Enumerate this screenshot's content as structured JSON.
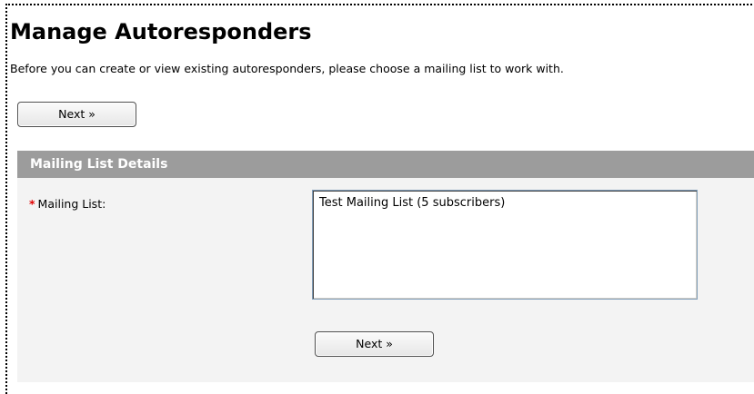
{
  "page": {
    "title": "Manage Autoresponders",
    "intro": "Before you can create or view existing autoresponders, please choose a mailing list to work with."
  },
  "buttons": {
    "next_top": "Next »",
    "next_bottom": "Next »"
  },
  "section": {
    "title": "Mailing List Details",
    "field_label": "Mailing List:",
    "required_marker": "*",
    "options": [
      "Test Mailing List (5 subscribers)"
    ]
  },
  "colors": {
    "section_header": "#9c9c9c",
    "section_body": "#f3f3f3",
    "required": "#e00000"
  }
}
